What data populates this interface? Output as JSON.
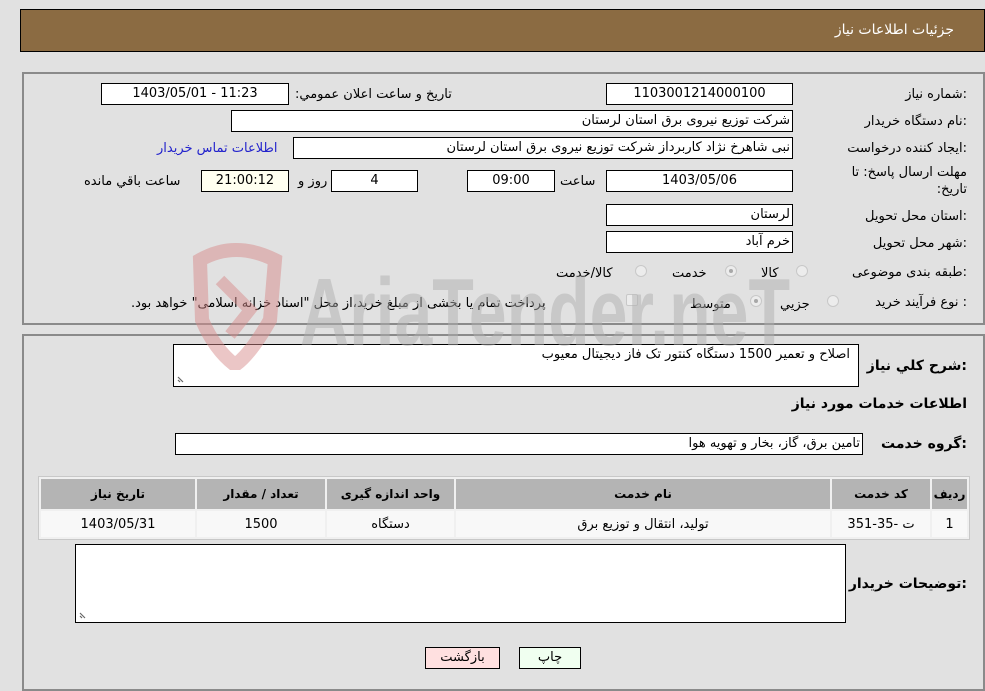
{
  "header": {
    "title": "جزئیات اطلاعات نیاز"
  },
  "fields": {
    "need_number_label": "شماره نیاز:",
    "need_number": "1103001214000100",
    "announce_label": "تاریخ و ساعت اعلان عمومي:",
    "announce_value": "1403/05/01 - 11:23",
    "buyer_org_label": "نام دستگاه خریدار:",
    "buyer_org": "شرکت توزیع نیروی برق استان لرستان",
    "creator_label": "ایجاد کننده درخواست:",
    "creator": "نبی شاهرخ نژاد کاربرداز شرکت توزیع نیروی برق استان لرستان",
    "contact_link": "اطلاعات تماس خریدار",
    "deadline_label_line1": "مهلت ارسال پاسخ: تا",
    "deadline_label_line2": "تاریخ:",
    "deadline_date": "1403/05/06",
    "time_label": "ساعت",
    "deadline_time": "09:00",
    "days_value": "4",
    "days_label": "روز و",
    "remaining_time": "21:00:12",
    "remaining_label": "ساعت باقي مانده",
    "province_label": "استان محل تحویل:",
    "province": "لرستان",
    "city_label": "شهر محل تحویل:",
    "city": "خرم آباد",
    "category_label": "طبقه بندی موضوعی:",
    "category_options": [
      "کالا",
      "خدمت",
      "کالا/خدمت"
    ],
    "category_selected": "خدمت",
    "process_label": "نوع فرآیند خرید :",
    "process_options": [
      "جزيي",
      "متوسط"
    ],
    "process_selected": "متوسط",
    "treasury_note": "پرداخت تمام یا بخشی از مبلغ خرید،از محل \"اسناد خزانه اسلامی\" خواهد بود."
  },
  "details": {
    "description_label": "شرح کلي نیاز:",
    "description": "اصلاح و تعمیر 1500 دستگاه کنتور تک فاز دیجیتال معیوب",
    "services_heading": "اطلاعات خدمات مورد نیاز",
    "service_group_label": "گروه خدمت:",
    "service_group": "تامین برق، گاز، بخار و تهویه هوا",
    "table": {
      "headers": [
        "ردیف",
        "کد خدمت",
        "نام خدمت",
        "واحد اندازه گیری",
        "تعداد / مقدار",
        "تاریخ نیاز"
      ],
      "rows": [
        [
          "1",
          "ت -35-351",
          "تولید، انتقال و توزیع برق",
          "دستگاه",
          "1500",
          "1403/05/31"
        ]
      ]
    },
    "buyer_notes_label": "توضیحات خریدار:",
    "buyer_notes": ""
  },
  "buttons": {
    "print": "چاپ",
    "back": "بازگشت"
  },
  "watermark": {
    "text": "AriaTender.neT"
  },
  "colors": {
    "header_bg": "#8b6b42",
    "print_bg": "#f0fff0",
    "back_bg": "#ffe0e0",
    "link": "#2222cc"
  }
}
